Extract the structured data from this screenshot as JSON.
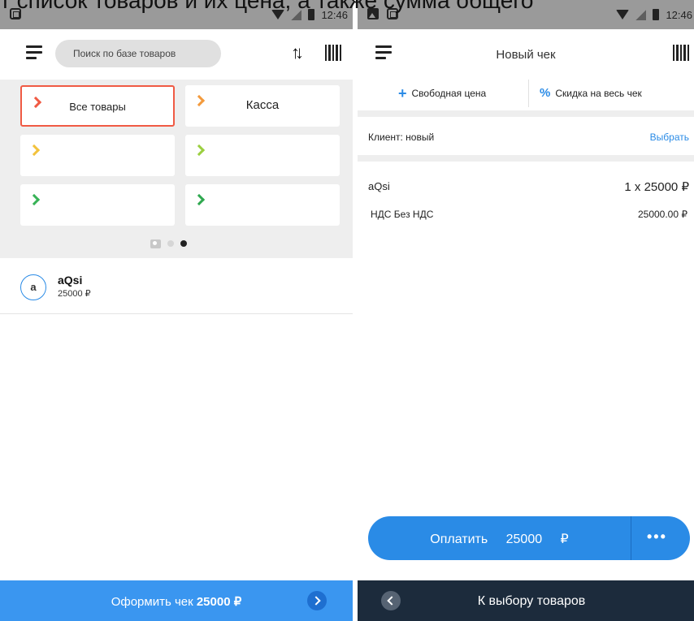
{
  "caption": "т список товаров и их цена, а также сумма общего",
  "left": {
    "status": {
      "time": "12:46"
    },
    "search": {
      "placeholder": "Поиск по базе товаров"
    },
    "sort_label": "↑↓",
    "tiles": [
      {
        "label": "Все товары",
        "color": "#f05a44",
        "selected": true
      },
      {
        "label": "Касса",
        "color": "#f39a3c"
      },
      {
        "label": "",
        "color": "#f2c23c"
      },
      {
        "label": "",
        "color": "#9bcf40"
      },
      {
        "label": "",
        "color": "#37b256"
      },
      {
        "label": "",
        "color": "#2fa84f"
      }
    ],
    "products": [
      {
        "avatar": "a",
        "name": "aQsi",
        "price": "25000 ₽"
      }
    ],
    "checkout": {
      "label": "Оформить чек",
      "total": "25000 ₽"
    }
  },
  "right": {
    "status": {
      "time": "12:46"
    },
    "title": "Новый чек",
    "actions": [
      {
        "symbol": "+",
        "label": "Свободная цена"
      },
      {
        "symbol": "%",
        "label": "Скидка на весь чек"
      }
    ],
    "client": {
      "label": "Клиент: новый",
      "select_label": "Выбрать"
    },
    "line": {
      "name": "aQsi",
      "qty_price": "1 x 25000 ₽",
      "vat_label": "НДС Без НДС",
      "vat_sum": "25000.00 ₽"
    },
    "pay": {
      "label": "Оплатить 25000 ₽",
      "more": "•••"
    },
    "back_label": "К выбору товаров"
  },
  "colors": {
    "accent": "#2a8be6",
    "checkout_bar": "#3a96f0",
    "bottom_dark": "#1c2b3c"
  }
}
